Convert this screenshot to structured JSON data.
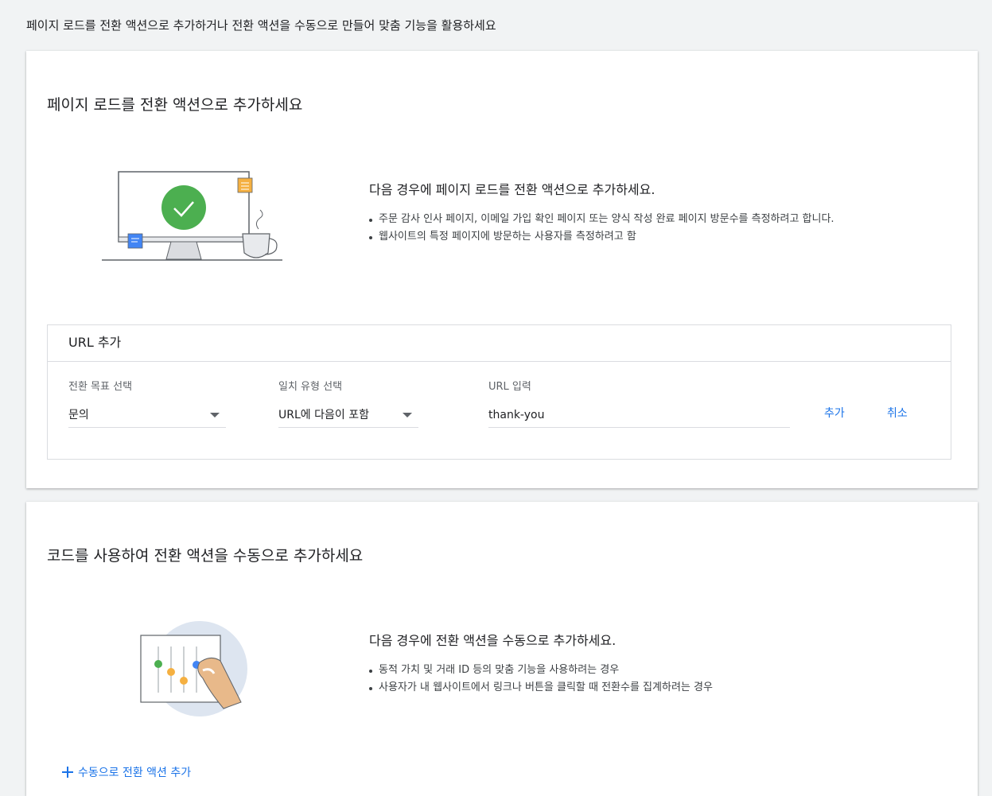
{
  "header": {
    "title": "페이지 로드를 전환 액션으로 추가하거나 전환 액션을 수동으로 만들어 맞춤 기능을 활용하세요"
  },
  "page_load_card": {
    "title": "페이지 로드를 전환 액션으로 추가하세요",
    "illustration_icon": "monitor-checkmark-illustration",
    "desc_title": "다음 경우에 페이지 로드를 전환 액션으로 추가하세요.",
    "bullets": [
      "주문 감사 인사 페이지, 이메일 가입 확인 페이지 또는 양식 작성 완료 페이지 방문수를 측정하려고 합니다.",
      "웹사이트의 특정 페이지에 방문하는 사용자를 측정하려고 함"
    ],
    "url_panel": {
      "title": "URL 추가",
      "goal_label": "전환 목표 선택",
      "goal_value": "문의",
      "match_label": "일치 유형 선택",
      "match_value": "URL에 다음이 포함",
      "url_label": "URL 입력",
      "url_value": "thank-you",
      "add_label": "추가",
      "cancel_label": "취소"
    }
  },
  "manual_card": {
    "title": "코드를 사용하여 전환 액션을 수동으로 추가하세요",
    "illustration_icon": "hand-sliders-illustration",
    "desc_title": "다음 경우에 전환 액션을 수동으로 추가하세요.",
    "bullets": [
      "동적 가치 및 거래 ID 등의 맞춤 기능을 사용하려는 경우",
      "사용자가 내 웹사이트에서 링크나 버튼을 클릭할 때 전환수를 집계하려는 경우"
    ],
    "add_label": "수동으로 전환 액션 추가"
  },
  "colors": {
    "accent": "#1a73e8",
    "check_green": "#4caf50",
    "background": "#f1f3f4"
  }
}
